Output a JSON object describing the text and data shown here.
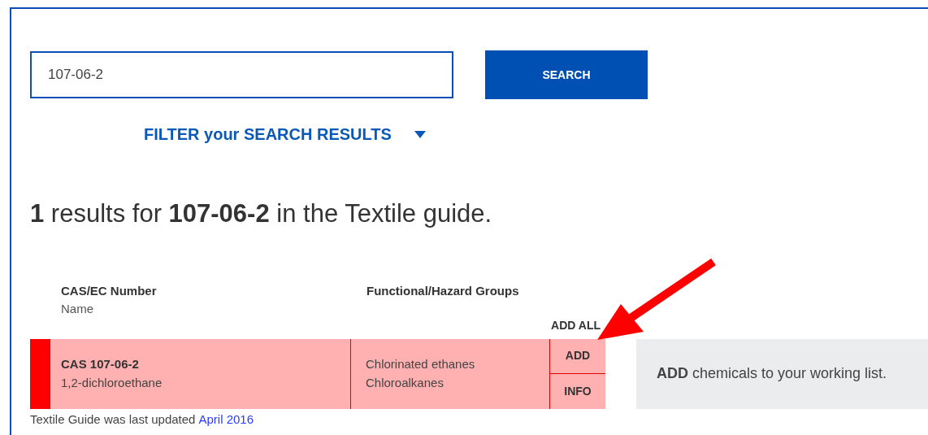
{
  "search": {
    "value": "107-06-2",
    "button": "SEARCH"
  },
  "filter": {
    "label": "FILTER your SEARCH RESULTS",
    "expanded": false
  },
  "results_heading": "**1** results for **107-06-2** in the Textile guide.",
  "table": {
    "columns": [
      {
        "title": "CAS/EC Number",
        "subtitle": "Name"
      },
      {
        "title": "Functional/Hazard Groups"
      }
    ],
    "add_all": "ADD ALL",
    "rows": [
      {
        "cas": "CAS 107-06-2",
        "name": "1,2-dichloroethane",
        "groups": [
          "Chlorinated ethanes",
          "Chloroalkanes"
        ],
        "color": "#ff0000",
        "add": "ADD",
        "info": "INFO"
      }
    ]
  },
  "tooltip": "**ADD** chemicals to your working list.",
  "footer": {
    "text": "Textile Guide was last updated",
    "link": "April 2016"
  }
}
